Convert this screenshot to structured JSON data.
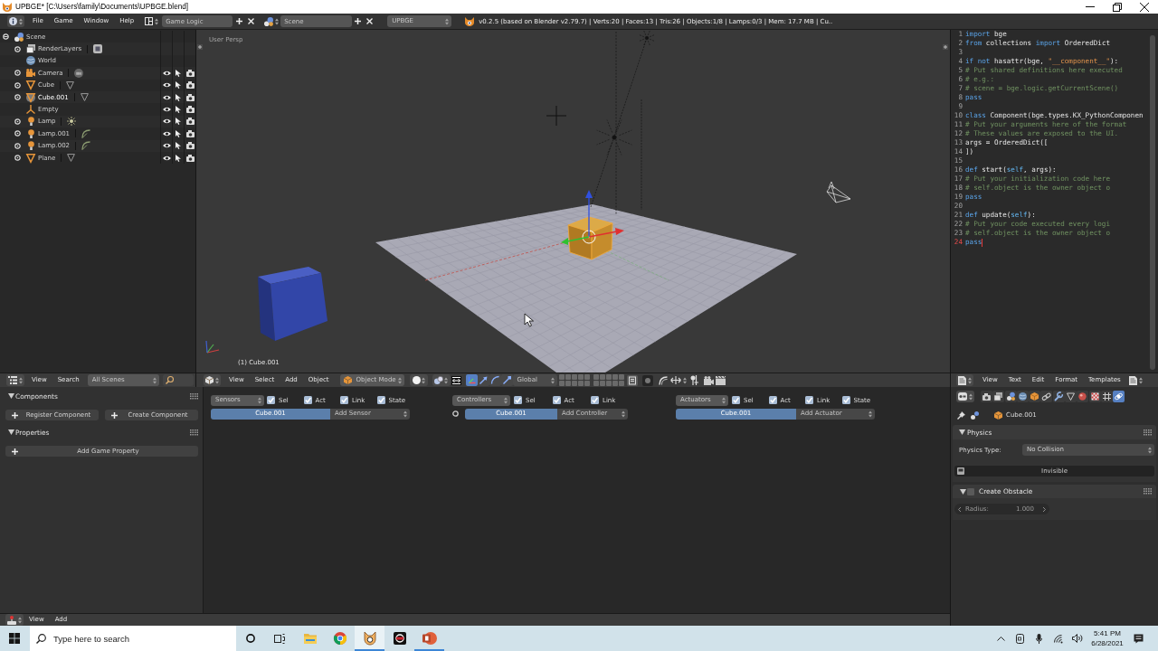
{
  "window": {
    "title": "UPBGE* [C:\\Users\\family\\Documents\\UPBGE.blend]"
  },
  "info_header": {
    "menus": [
      "File",
      "Game",
      "Window",
      "Help"
    ],
    "screen_layout": "Game Logic",
    "scene": "Scene",
    "engine": "UPBGE",
    "stats": "v0.2.5 (based on Blender v2.79.7) | Verts:20 | Faces:13 | Tris:26 | Objects:1/8 | Lamps:0/3 | Mem: 17.7 MB | Cu.."
  },
  "outliner": {
    "items": [
      {
        "label": "Scene",
        "kind": "scene",
        "selected": false,
        "children": [
          {
            "label": "RenderLayers",
            "kind": "render_layers",
            "selected": false
          },
          {
            "label": "World",
            "kind": "world",
            "selected": false
          },
          {
            "label": "Camera",
            "kind": "camera",
            "selected": false
          },
          {
            "label": "Cube",
            "kind": "mesh",
            "selected": false
          },
          {
            "label": "Cube.001",
            "kind": "mesh",
            "selected": true
          },
          {
            "label": "Empty",
            "kind": "empty",
            "selected": false
          },
          {
            "label": "Lamp",
            "kind": "sun_lamp",
            "selected": false
          },
          {
            "label": "Lamp.001",
            "kind": "spot_lamp",
            "selected": false
          },
          {
            "label": "Lamp.002",
            "kind": "spot_lamp",
            "selected": false
          },
          {
            "label": "Plane",
            "kind": "mesh",
            "selected": false
          }
        ]
      }
    ],
    "header": {
      "menus": [
        "View",
        "Search"
      ],
      "filter": "All Scenes"
    }
  },
  "viewport": {
    "view_label": "User Persp",
    "object_label": "(1) Cube.001",
    "header": {
      "menus": [
        "View",
        "Select",
        "Add",
        "Object"
      ],
      "mode": "Object Mode",
      "orientation": "Global",
      "manipulators": [
        {
          "kind": "axes",
          "on": true
        },
        {
          "kind": "translate",
          "on": false
        },
        {
          "kind": "rotate",
          "on": false
        },
        {
          "kind": "scale",
          "on": false
        }
      ]
    }
  },
  "text_editor": {
    "lines": [
      {
        "number": "1",
        "current": false,
        "tokens": [
          {
            "kind": "keyword",
            "text": "import"
          },
          {
            "kind": "plain",
            "text": " bge"
          }
        ]
      },
      {
        "number": "2",
        "current": false,
        "tokens": [
          {
            "kind": "keyword",
            "text": "from"
          },
          {
            "kind": "plain",
            "text": " collections "
          },
          {
            "kind": "keyword",
            "text": "import"
          },
          {
            "kind": "plain",
            "text": " OrderedDict"
          }
        ]
      },
      {
        "number": "3",
        "current": false
      },
      {
        "number": "4",
        "current": false,
        "tokens": [
          {
            "kind": "keyword",
            "text": "if not"
          },
          {
            "kind": "plain",
            "text": " hasattr(bge, "
          },
          {
            "kind": "string",
            "text": "\"__component__\""
          },
          {
            "kind": "plain",
            "text": "):"
          }
        ]
      },
      {
        "number": "5",
        "current": false,
        "tokens": [
          {
            "kind": "comment",
            "text": "    # Put shared definitions here executed"
          }
        ]
      },
      {
        "number": "6",
        "current": false,
        "tokens": [
          {
            "kind": "comment",
            "text": "    # e.g.:"
          }
        ]
      },
      {
        "number": "7",
        "current": false,
        "tokens": [
          {
            "kind": "comment",
            "text": "    # scene = bge.logic.getCurrentScene()"
          }
        ]
      },
      {
        "number": "8",
        "current": false,
        "tokens": [
          {
            "kind": "keyword",
            "text": "    pass"
          }
        ]
      },
      {
        "number": "9",
        "current": false
      },
      {
        "number": "10",
        "current": false,
        "tokens": [
          {
            "kind": "keyword",
            "text": "class"
          },
          {
            "kind": "plain",
            "text": " Component(bge.types.KX_PythonComponen"
          }
        ]
      },
      {
        "number": "11",
        "current": false,
        "tokens": [
          {
            "kind": "comment",
            "text": "    # Put your arguments here of the format"
          }
        ]
      },
      {
        "number": "12",
        "current": false,
        "tokens": [
          {
            "kind": "comment",
            "text": "    # These values are exposed to the UI."
          }
        ]
      },
      {
        "number": "13",
        "current": false,
        "tokens": [
          {
            "kind": "plain",
            "text": "    args = OrderedDict(["
          }
        ]
      },
      {
        "number": "14",
        "current": false,
        "tokens": [
          {
            "kind": "plain",
            "text": "    ])"
          }
        ]
      },
      {
        "number": "15",
        "current": false
      },
      {
        "number": "16",
        "current": false,
        "tokens": [
          {
            "kind": "keyword",
            "text": "    def"
          },
          {
            "kind": "plain",
            "text": " start("
          },
          {
            "kind": "self",
            "text": "self"
          },
          {
            "kind": "plain",
            "text": ", args):"
          }
        ]
      },
      {
        "number": "17",
        "current": false,
        "tokens": [
          {
            "kind": "comment",
            "text": "        # Put your initialization code here"
          }
        ]
      },
      {
        "number": "18",
        "current": false,
        "tokens": [
          {
            "kind": "comment",
            "text": "        # self.object is the owner object o"
          }
        ]
      },
      {
        "number": "19",
        "current": false,
        "tokens": [
          {
            "kind": "keyword",
            "text": "        pass"
          }
        ]
      },
      {
        "number": "20",
        "current": false
      },
      {
        "number": "21",
        "current": false,
        "tokens": [
          {
            "kind": "keyword",
            "text": "    def"
          },
          {
            "kind": "plain",
            "text": " update("
          },
          {
            "kind": "self",
            "text": "self"
          },
          {
            "kind": "plain",
            "text": "):"
          }
        ]
      },
      {
        "number": "22",
        "current": false,
        "tokens": [
          {
            "kind": "comment",
            "text": "        # Put your code executed every logi"
          }
        ]
      },
      {
        "number": "23",
        "current": false,
        "tokens": [
          {
            "kind": "comment",
            "text": "        # self.object is the owner object o"
          }
        ]
      },
      {
        "number": "24",
        "current": true,
        "tokens": [
          {
            "kind": "keyword",
            "text": "        pass"
          }
        ]
      }
    ],
    "header": {
      "menus": [
        "View",
        "Text",
        "Edit",
        "Format",
        "Templates"
      ]
    }
  },
  "logic": {
    "shelf": [
      {
        "title": "Components",
        "expanded": true,
        "buttons": [
          "Register Component",
          "Create Component"
        ]
      },
      {
        "title": "Properties",
        "expanded": true,
        "buttons": [
          "Add Game Property"
        ]
      }
    ],
    "columns": [
      {
        "kind": "sensors",
        "title": "Sensors",
        "filters": [
          {
            "label": "Sel",
            "checked": true
          },
          {
            "label": "Act",
            "checked": true
          },
          {
            "label": "Link",
            "checked": true
          },
          {
            "label": "State",
            "checked": true
          }
        ],
        "object": "Cube.001",
        "add": "Add Sensor"
      },
      {
        "kind": "controllers",
        "title": "Controllers",
        "filters": [
          {
            "label": "Sel",
            "checked": true
          },
          {
            "label": "Act",
            "checked": true
          },
          {
            "label": "Link",
            "checked": true
          }
        ],
        "object": "Cube.001",
        "add": "Add Controller"
      },
      {
        "kind": "actuators",
        "title": "Actuators",
        "filters": [
          {
            "label": "Sel",
            "checked": true
          },
          {
            "label": "Act",
            "checked": true
          },
          {
            "label": "Link",
            "checked": true
          },
          {
            "label": "State",
            "checked": true
          }
        ],
        "object": "Cube.001",
        "add": "Add Actuator"
      }
    ],
    "header": {
      "menus": [
        "View",
        "Add"
      ]
    }
  },
  "properties": {
    "tabs": [
      {
        "kind": "render",
        "selected": false
      },
      {
        "kind": "render_layers",
        "selected": false
      },
      {
        "kind": "scene",
        "selected": false
      },
      {
        "kind": "world",
        "selected": false
      },
      {
        "kind": "object",
        "selected": false
      },
      {
        "kind": "constraints",
        "selected": false
      },
      {
        "kind": "modifiers",
        "selected": false
      },
      {
        "kind": "data",
        "selected": false
      },
      {
        "kind": "material",
        "selected": false
      },
      {
        "kind": "texture",
        "selected": false
      },
      {
        "kind": "particles",
        "selected": false
      },
      {
        "kind": "physics",
        "selected": true
      }
    ],
    "context": "Cube.001",
    "physics": {
      "title": "Physics",
      "expanded": true,
      "type_label": "Physics Type:",
      "type_value": "No Collision",
      "invisible": {
        "label": "Invisible",
        "on": false
      }
    },
    "obstacle": {
      "title": "Create Obstacle",
      "expanded": true,
      "checked": false,
      "radius": {
        "label": "Radius:",
        "value": "1.000",
        "disabled": true
      }
    }
  },
  "taskbar": {
    "search": {
      "placeholder": "Type here to search"
    },
    "apps": [
      {
        "kind": "file_explorer",
        "running": false,
        "active": false
      },
      {
        "kind": "chrome",
        "running": false,
        "active": false
      },
      {
        "kind": "upbge",
        "running": true,
        "active": true
      },
      {
        "kind": "app",
        "running": false,
        "active": false
      },
      {
        "kind": "powerpoint",
        "running": true,
        "active": false
      }
    ],
    "clock": {
      "time": "5:41 PM",
      "date": "6/28/2021"
    }
  }
}
